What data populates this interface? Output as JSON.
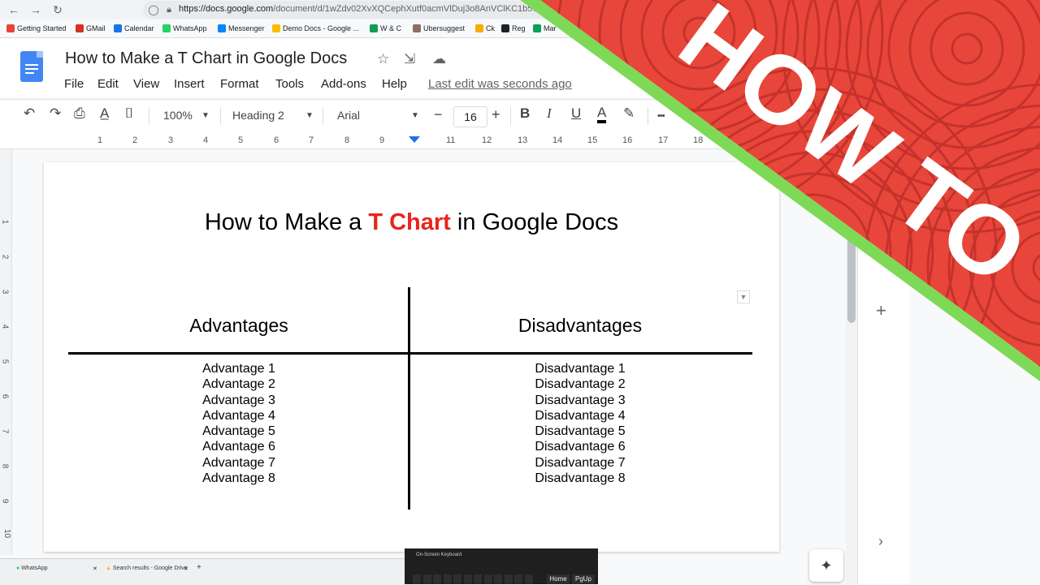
{
  "browser": {
    "url_host": "https://docs.google.com",
    "url_path": "/document/d/1wZdv02XvXQCephXutf0acmVlDuj3o8AnVClKC1b5vNQ",
    "bookmarks": [
      "Getting Started",
      "GMail",
      "Calendar",
      "WhatsApp",
      "Messenger",
      "Demo Docs - Google ...",
      "W & C",
      "Ubersuggest",
      "Ck",
      "Reg",
      "Mar"
    ]
  },
  "docs": {
    "title": "How to Make a T Chart in Google Docs",
    "menu": [
      "File",
      "Edit",
      "View",
      "Insert",
      "Format",
      "Tools",
      "Add-ons",
      "Help"
    ],
    "last_edit": "Last edit was seconds ago"
  },
  "toolbar": {
    "zoom": "100%",
    "style": "Heading 2",
    "font": "Arial",
    "font_size": "16",
    "minus": "−",
    "plus": "+",
    "more": "•••"
  },
  "ruler": {
    "numbers": [
      "1",
      "2",
      "3",
      "4",
      "5",
      "6",
      "7",
      "8",
      "9",
      "11",
      "12",
      "13",
      "14",
      "15",
      "16",
      "17",
      "18"
    ],
    "vertical_numbers": [
      "1",
      "2",
      "3",
      "4",
      "5",
      "6",
      "7",
      "8",
      "9",
      "10"
    ]
  },
  "document": {
    "heading_before": "How to Make a ",
    "heading_highlight": "T Chart",
    "heading_after": " in Google Docs",
    "left_header": "Advantages",
    "right_header": "Disadvantages",
    "advantages": [
      "Advantage 1",
      "Advantage 2",
      "Advantage 3",
      "Advantage 4",
      "Advantage 5",
      "Advantage 6",
      "Advantage 7",
      "Advantage 8"
    ],
    "disadvantages": [
      "Disadvantage 1",
      "Disadvantage 2",
      "Disadvantage 3",
      "Disadvantage 4",
      "Disadvantage 5",
      "Disadvantage 6",
      "Disadvantage 7",
      "Disadvantage 8"
    ]
  },
  "taskbar": {
    "tabs": [
      "WhatsApp",
      "Search results - Google Drive"
    ],
    "osk_title": "On-Screen Keyboard",
    "osk_keys": [
      "Home",
      "PgUp"
    ]
  },
  "banner": {
    "text": "HOW TO",
    "colors": {
      "red": "#e8463a",
      "green": "#7ed957"
    }
  }
}
